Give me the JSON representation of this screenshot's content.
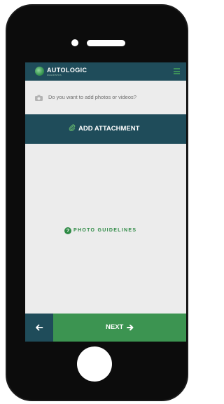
{
  "app": {
    "brand": "AUTOLOGIC",
    "brand_sub": "DIAGNOSTICS"
  },
  "prompt": {
    "text": "Do you want to add photos or videos?",
    "icon": "camera-icon"
  },
  "attach_button": {
    "label": "ADD ATTACHMENT",
    "icon": "paperclip-icon"
  },
  "guidelines": {
    "label": "PHOTO GUIDELINES",
    "icon": "help-icon",
    "icon_glyph": "?"
  },
  "footer": {
    "back_icon": "arrow-left-icon",
    "next_label": "NEXT",
    "next_icon": "arrow-right-icon"
  },
  "colors": {
    "header": "#1f4c5a",
    "accent_green": "#3c9451",
    "background": "#ececec"
  }
}
